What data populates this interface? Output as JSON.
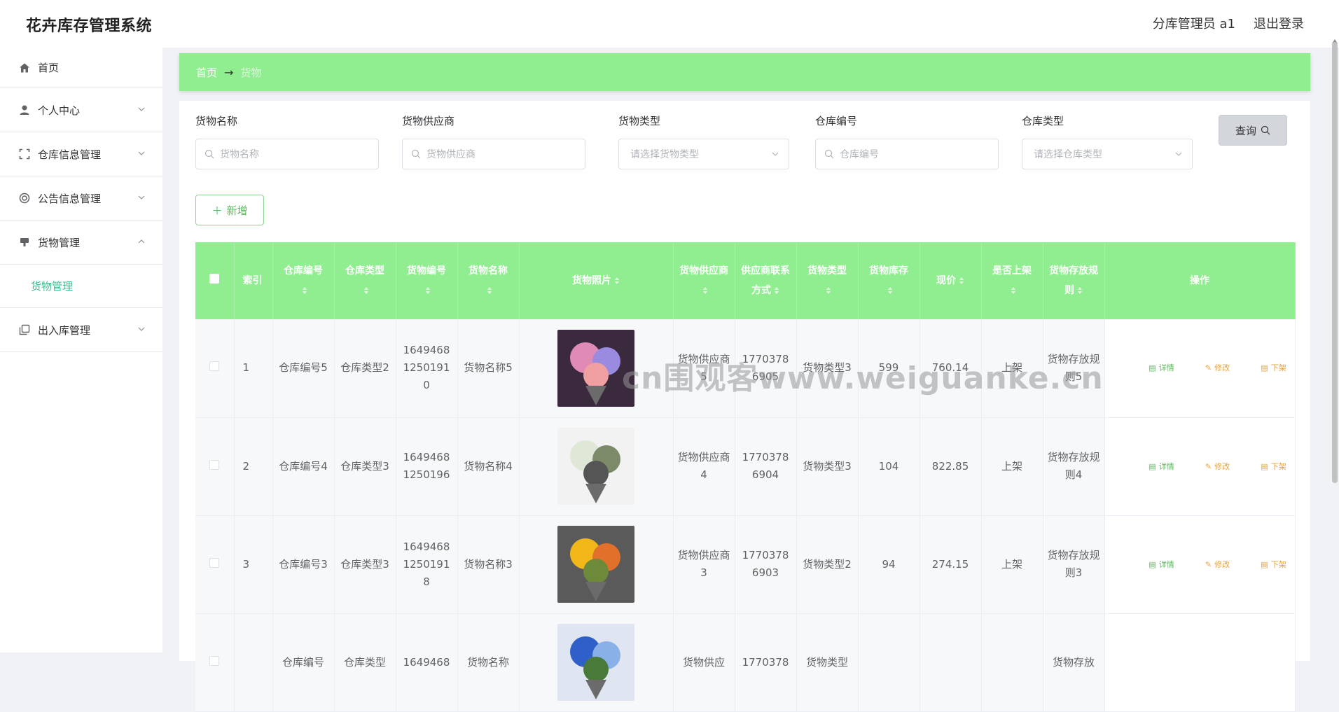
{
  "app": {
    "title": "花卉库存管理系统"
  },
  "header": {
    "user": "分库管理员 a1",
    "logout": "退出登录"
  },
  "sidebar": {
    "items": [
      {
        "label": "首页",
        "icon": "home-icon"
      },
      {
        "label": "个人中心",
        "icon": "user-icon"
      },
      {
        "label": "仓库信息管理",
        "icon": "scan-icon"
      },
      {
        "label": "公告信息管理",
        "icon": "help-ring-icon"
      },
      {
        "label": "货物管理",
        "icon": "goods-icon",
        "expanded": true,
        "children": [
          {
            "label": "货物管理"
          }
        ]
      },
      {
        "label": "出入库管理",
        "icon": "copy-icon"
      }
    ]
  },
  "breadcrumb": {
    "home": "首页",
    "current": "货物"
  },
  "search": {
    "fields": [
      {
        "label": "货物名称",
        "placeholder": "货物名称"
      },
      {
        "label": "货物供应商",
        "placeholder": "货物供应商"
      },
      {
        "label": "货物类型",
        "placeholder": "请选择货物类型"
      },
      {
        "label": "仓库编号",
        "placeholder": "仓库编号"
      },
      {
        "label": "仓库类型",
        "placeholder": "请选择仓库类型"
      }
    ],
    "query_label": "查询"
  },
  "add_label": "新增",
  "table": {
    "headers": [
      "索引",
      "仓库编号",
      "仓库类型",
      "货物编号",
      "货物名称",
      "货物照片",
      "货物供应商",
      "供应商联系方式",
      "货物类型",
      "货物库存",
      "现价",
      "是否上架",
      "货物存放规则",
      "操作"
    ],
    "actions": {
      "view": "详情",
      "edit": "修改",
      "off": "下架"
    },
    "rows": [
      {
        "index": "1",
        "warehouse_no": "仓库编号5",
        "warehouse_type": "仓库类型2",
        "goods_no": "16494681250191 0",
        "goods_name": "货物名称5",
        "supplier": "货物供应商5",
        "phone": "17703786905",
        "goods_type": "货物类型3",
        "stock": "599",
        "price": "760.14",
        "on_shelf": "上架",
        "rule": "货物存放规则5"
      },
      {
        "index": "2",
        "warehouse_no": "仓库编号4",
        "warehouse_type": "仓库类型3",
        "goods_no": "16494681250196",
        "goods_name": "货物名称4",
        "supplier": "货物供应商4",
        "phone": "17703786904",
        "goods_type": "货物类型3",
        "stock": "104",
        "price": "822.85",
        "on_shelf": "上架",
        "rule": "货物存放规则4"
      },
      {
        "index": "3",
        "warehouse_no": "仓库编号3",
        "warehouse_type": "仓库类型3",
        "goods_no": "16494681250191 8",
        "goods_name": "货物名称3",
        "supplier": "货物供应商3",
        "phone": "17703786903",
        "goods_type": "货物类型2",
        "stock": "94",
        "price": "274.15",
        "on_shelf": "上架",
        "rule": "货物存放规则3"
      },
      {
        "index": "",
        "warehouse_no": "仓库编号",
        "warehouse_type": "仓库类型",
        "goods_no": "1649468",
        "goods_name": "货物名称",
        "supplier": "货物供应",
        "phone": "1770378",
        "goods_type": "货物类型",
        "stock": "",
        "price": "",
        "on_shelf": "",
        "rule": "货物存放"
      }
    ]
  },
  "watermark": "cn围观客www.weiguanke.cn",
  "colors": {
    "accent": "#90ee90",
    "active_text": "#3dbb8f",
    "view": "#5cb85c",
    "edit": "#e6a23c"
  }
}
